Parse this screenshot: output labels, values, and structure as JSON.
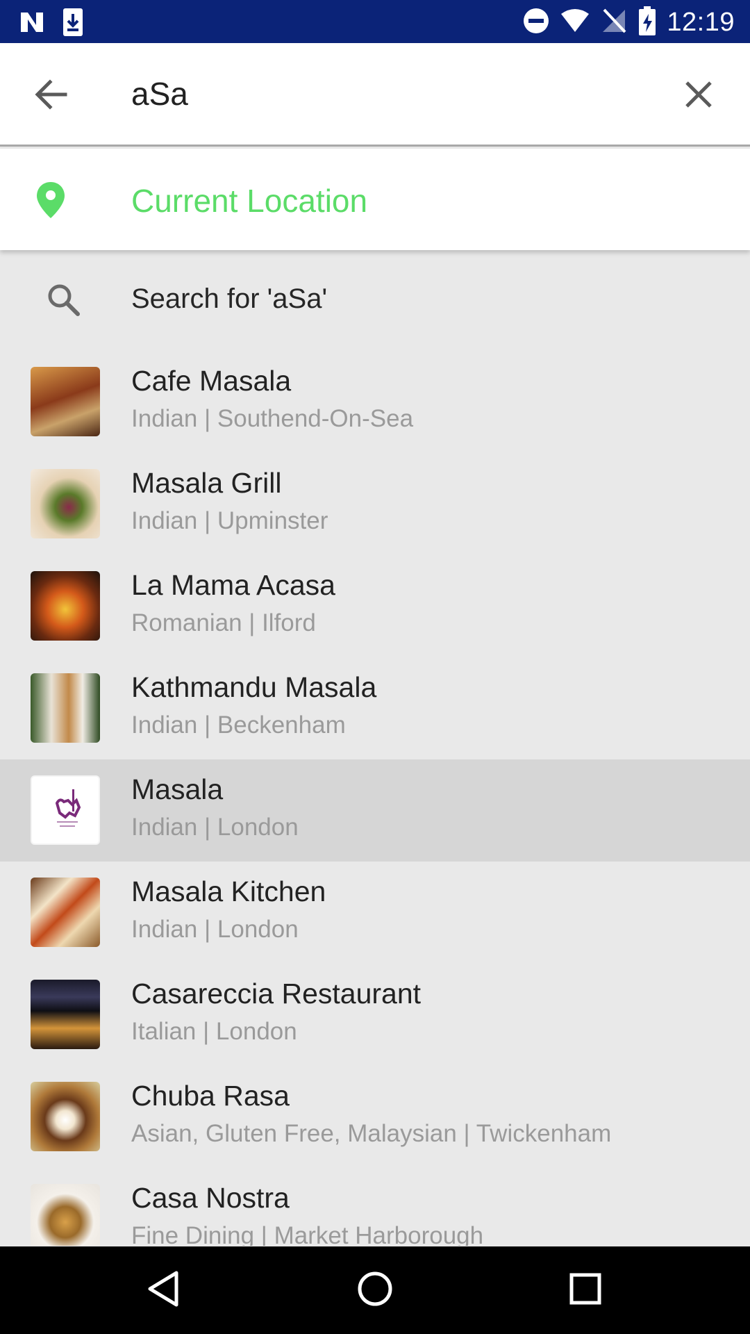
{
  "status_bar": {
    "time": "12:19",
    "left_icons": [
      "n-logo-icon",
      "download-icon"
    ],
    "right_icons": [
      "do-not-disturb-icon",
      "wifi-icon",
      "no-signal-icon",
      "battery-icon"
    ]
  },
  "search": {
    "query": "aSa"
  },
  "current_location": {
    "label": "Current Location",
    "accent": "#5bdc68"
  },
  "search_for": {
    "label": "Search for 'aSa'"
  },
  "results": [
    {
      "name": "Cafe Masala",
      "sub": "Indian | Southend-On-Sea"
    },
    {
      "name": "Masala Grill",
      "sub": "Indian | Upminster"
    },
    {
      "name": "La Mama Acasa",
      "sub": "Romanian | Ilford"
    },
    {
      "name": "Kathmandu Masala",
      "sub": "Indian | Beckenham"
    },
    {
      "name": "Masala",
      "sub": "Indian | London"
    },
    {
      "name": "Masala Kitchen",
      "sub": "Indian | London"
    },
    {
      "name": "Casareccia Restaurant",
      "sub": "Italian | London"
    },
    {
      "name": "Chuba Rasa",
      "sub": "Asian, Gluten Free, Malaysian |  Twickenham"
    },
    {
      "name": "Casa Nostra",
      "sub": "Fine Dining | Market Harborough"
    }
  ],
  "colors": {
    "status_bar": "#0b2378",
    "list_bg": "#e9e9e9",
    "highlight_row": "#d6d6d6"
  },
  "nav": {
    "icons": [
      "back-triangle-icon",
      "home-circle-icon",
      "recents-square-icon"
    ]
  }
}
